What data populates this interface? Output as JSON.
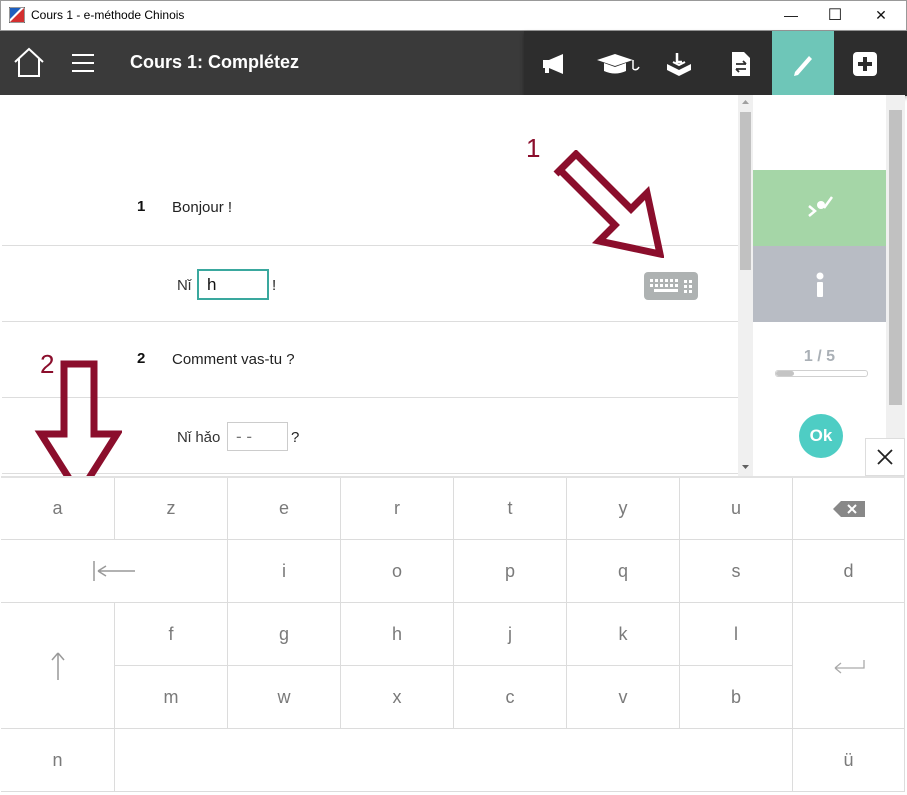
{
  "window": {
    "title": "Cours 1 - e-méthode Chinois",
    "minimize_glyph": "—",
    "maximize_glyph": "☐",
    "close_glyph": "✕"
  },
  "header": {
    "title": "Cours 1: Complétez",
    "tools": [
      "megaphone-icon",
      "graduation-cap-icon",
      "inkpot-icon",
      "document-swap-icon",
      "pencil-icon",
      "plus-box-icon"
    ],
    "active_tool": "pencil-icon"
  },
  "exercise": {
    "items": [
      {
        "number": "1",
        "prompt": "Bonjour !",
        "answer_prefix": "Nǐ",
        "answer_value": "h",
        "answer_suffix": "!"
      },
      {
        "number": "2",
        "prompt": "Comment vas-tu ?",
        "answer_prefix": "Nǐ hǎo",
        "answer_placeholder": "- -",
        "answer_suffix": "?"
      }
    ]
  },
  "side_panel": {
    "page_counter": "1 / 5",
    "progress": 0.2,
    "ok_label": "Ok"
  },
  "annotations": {
    "arrow1_label": "1",
    "arrow2_label": "2"
  },
  "keyboard": {
    "row1": [
      "a",
      "z",
      "e",
      "r",
      "t",
      "y",
      "u"
    ],
    "row2": [
      "i",
      "o",
      "p",
      "q",
      "s",
      "d"
    ],
    "row3": [
      "f",
      "g",
      "h",
      "j",
      "k",
      "l"
    ],
    "row4": [
      "m",
      "w",
      "x",
      "c",
      "v",
      "b"
    ],
    "row5": [
      "n",
      "ü"
    ],
    "icons": [
      "backspace-icon",
      "tab-icon",
      "shift-icon",
      "enter-icon"
    ]
  },
  "colors": {
    "header_bg": "#3a3a3a",
    "accent_teal": "#4ecdc4",
    "active_tool": "#6ec6b8",
    "check_green": "#a5d6a7",
    "info_grey": "#b8bcc4",
    "annotation_red": "#8b0e2c"
  }
}
